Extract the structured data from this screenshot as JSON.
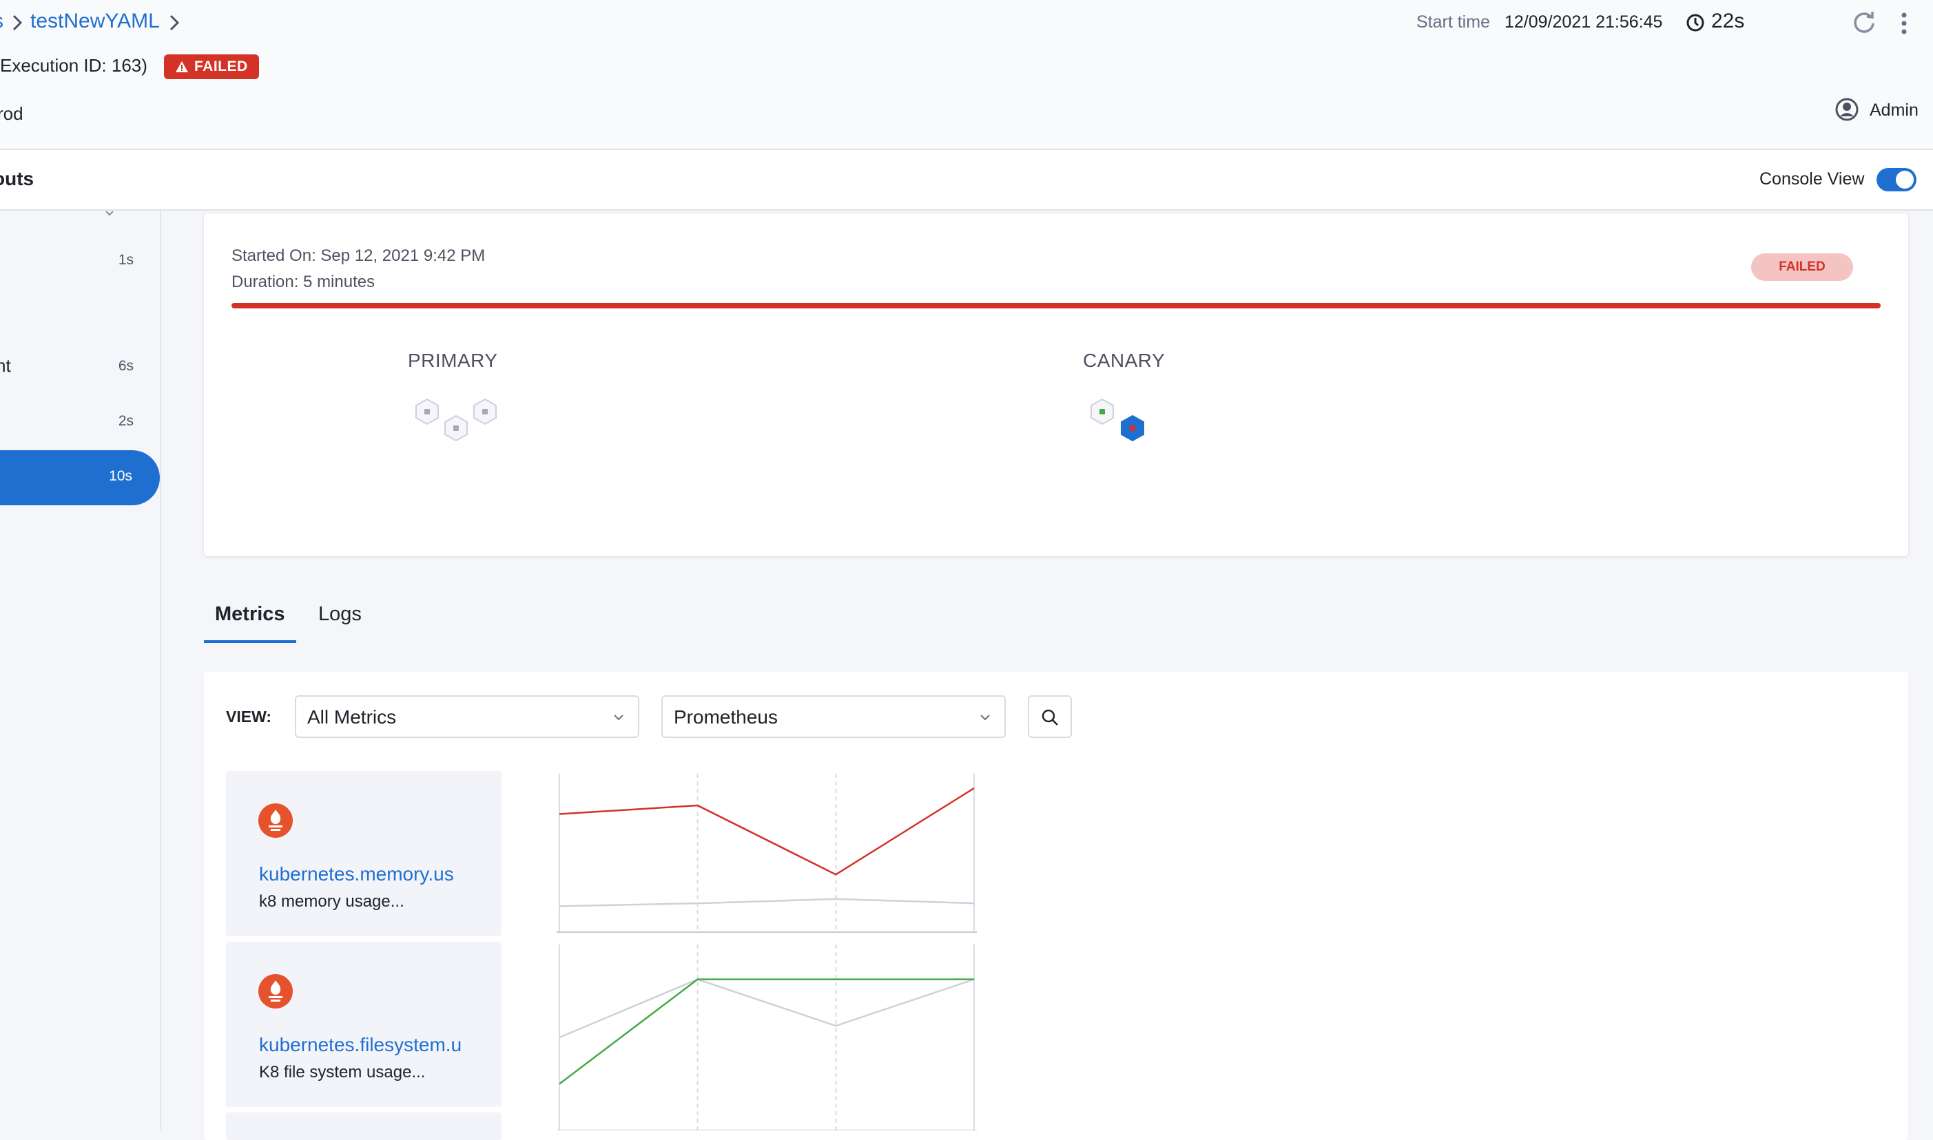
{
  "header": {
    "breadcrumb_prev": "s",
    "breadcrumb_current": "testNewYAML",
    "execution_id": "Execution ID: 163)",
    "status_badge": "FAILED",
    "environment": "rod",
    "start_time_label": "Start time",
    "start_time_value": "12/09/2021 21:56:45",
    "duration": "22s",
    "user": "Admin"
  },
  "subbar": {
    "title": "outs",
    "console_view_label": "Console View",
    "console_view_on": true
  },
  "sidebar": {
    "steps": [
      {
        "name": "",
        "duration": "1s"
      },
      {
        "name": "nt",
        "duration": "6s"
      },
      {
        "name": "",
        "duration": "2s"
      },
      {
        "name": "",
        "duration": "10s",
        "active": true
      }
    ]
  },
  "deployment": {
    "started_on": "Started On: Sep 12, 2021 9:42 PM",
    "duration": "Duration: 5 minutes",
    "status": "FAILED",
    "primary_label": "PRIMARY",
    "canary_label": "CANARY"
  },
  "tabs": [
    {
      "label": "Metrics",
      "active": true
    },
    {
      "label": "Logs",
      "active": false
    }
  ],
  "metrics_panel": {
    "view_label": "VIEW:",
    "metrics_filter": "All Metrics",
    "source_filter": "Prometheus",
    "cards": [
      {
        "name": "kubernetes.memory.us",
        "description": "k8 memory usage...",
        "icon": "prometheus-icon"
      },
      {
        "name": "kubernetes.filesystem.u",
        "description": "K8 file system usage...",
        "icon": "prometheus-icon"
      }
    ]
  },
  "colors": {
    "accent": "#1f6fd1",
    "failed": "#d33327",
    "success": "#42ab45",
    "prometheus": "#e6522c"
  },
  "chart_data": [
    {
      "type": "line",
      "x": [
        1,
        2,
        3,
        4
      ],
      "series": [
        {
          "values": [
            0.82,
            0.88,
            0.4,
            1.0
          ],
          "color": "#d33327"
        },
        {
          "values": [
            0.18,
            0.2,
            0.23,
            0.2
          ],
          "color": "#d0d0d8"
        }
      ],
      "ylim": [
        0,
        1.1
      ],
      "grid": true
    },
    {
      "type": "line",
      "x": [
        1,
        2,
        3,
        4
      ],
      "series": [
        {
          "values": [
            0.4,
            0.65,
            0.45,
            0.65
          ],
          "color": "#d0d0d8"
        },
        {
          "values": [
            0.2,
            0.65,
            0.65,
            0.65
          ],
          "color": "#42ab45"
        }
      ],
      "ylim": [
        0,
        0.8
      ],
      "grid": true
    }
  ]
}
